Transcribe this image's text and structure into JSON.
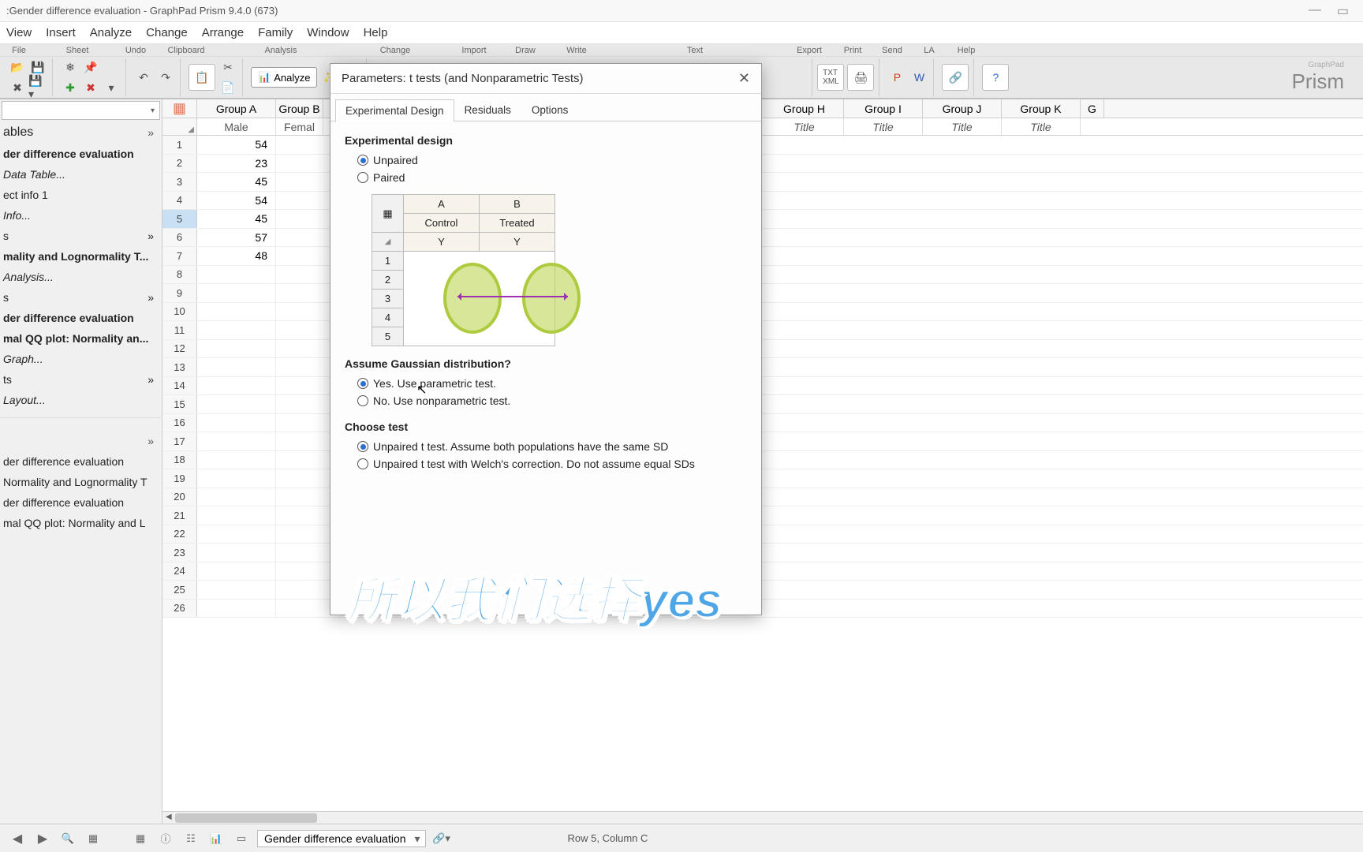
{
  "title": ":Gender difference evaluation - GraphPad Prism 9.4.0 (673)",
  "menu": {
    "view": "View",
    "insert": "Insert",
    "analyze": "Analyze",
    "change": "Change",
    "arrange": "Arrange",
    "family": "Family",
    "window": "Window",
    "help": "Help"
  },
  "ribbon_labels": {
    "file": "File",
    "sheet": "Sheet",
    "undo": "Undo",
    "clipboard": "Clipboard",
    "analysis": "Analysis",
    "change": "Change",
    "import": "Import",
    "draw": "Draw",
    "write": "Write",
    "text": "Text",
    "export": "Export",
    "print": "Print",
    "send": "Send",
    "la": "LA",
    "help": "Help"
  },
  "analyze_btn": "Analyze",
  "logo": {
    "brand": "Prism",
    "company": "GraphPad"
  },
  "sidebar": {
    "head": "ables",
    "items": [
      {
        "text": "der difference evaluation",
        "bold": true
      },
      {
        "text": " Data Table...",
        "italic": true
      },
      {
        "text": "ect info 1"
      },
      {
        "text": " Info...",
        "italic": true
      },
      {
        "text": "s"
      },
      {
        "text": "mality and Lognormality T...",
        "bold": true
      },
      {
        "text": " Analysis...",
        "italic": true
      },
      {
        "text": "s"
      },
      {
        "text": "der difference evaluation",
        "bold": true
      },
      {
        "text": "mal QQ plot: Normality an...",
        "bold": true
      },
      {
        "text": " Graph...",
        "italic": true
      },
      {
        "text": "ts"
      },
      {
        "text": " Layout...",
        "italic": true
      }
    ],
    "recent": [
      "der difference evaluation",
      "Normality and Lognormality T",
      "der difference evaluation",
      "mal QQ plot: Normality and L"
    ]
  },
  "columns": {
    "groups": [
      "Group A",
      "Group B",
      "Group H",
      "Group I",
      "Group J",
      "Group K",
      "G"
    ],
    "sublabels": [
      "Male",
      "Femal",
      "Title",
      "Title",
      "Title",
      "Title"
    ]
  },
  "data_values": [
    "54",
    "23",
    "45",
    "54",
    "45",
    "57",
    "48"
  ],
  "selected_row": 5,
  "num_rows": 26,
  "modal": {
    "title": "Parameters: t tests (and Nonparametric Tests)",
    "tabs": {
      "t1": "Experimental Design",
      "t2": "Residuals",
      "t3": "Options"
    },
    "section1": "Experimental design",
    "r_unpaired": "Unpaired",
    "r_paired": "Paired",
    "illus": {
      "a": "A",
      "b": "B",
      "ctrl": "Control",
      "treat": "Treated",
      "y": "Y"
    },
    "section2": "Assume Gaussian distribution?",
    "r_yes": "Yes. Use parametric test.",
    "r_no": "No. Use nonparametric test.",
    "section3": "Choose test",
    "r_same": "Unpaired t test. Assume both populations have the same SD",
    "r_welch": "Unpaired t test with Welch's correction. Do not assume equal SDs"
  },
  "caption": "所以我们选择yes",
  "status": {
    "sheet_dd": "Gender difference evaluation",
    "pos": "Row 5, Column C"
  }
}
